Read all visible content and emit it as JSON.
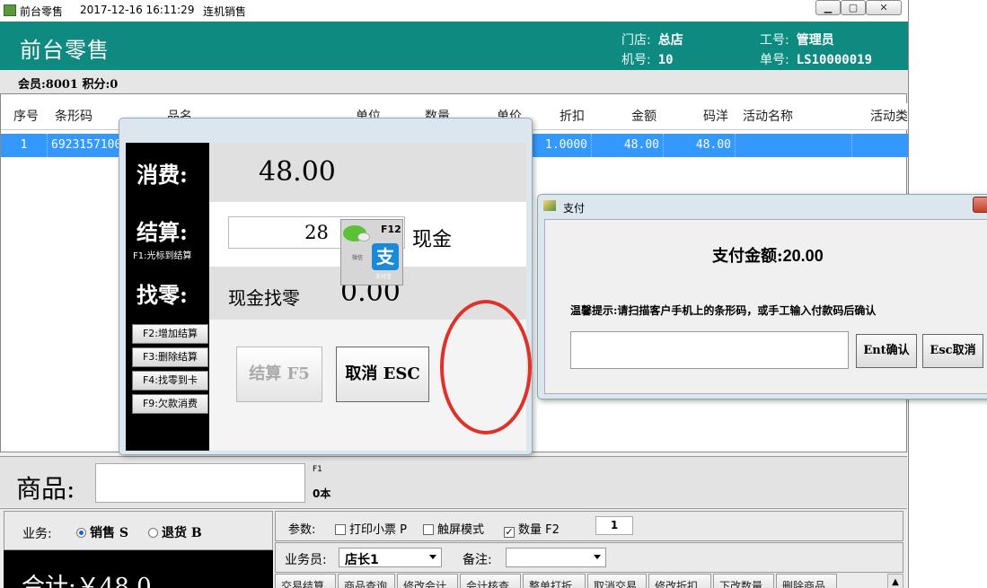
{
  "titlebar": {
    "app": "前台零售",
    "datetime": "2017-12-16 16:11:29",
    "mode": "连机销售"
  },
  "header": {
    "title": "前台零售",
    "store_label": "门店:",
    "store": "总店",
    "machine_label": "机号:",
    "machine": "10",
    "staff_label": "工号:",
    "staff": "管理员",
    "order_label": "单号:",
    "order": "LS10000019"
  },
  "member": {
    "text": "会员:8001 积分:0"
  },
  "grid": {
    "columns": [
      "序号",
      "条形码",
      "品名",
      "单位",
      "数量",
      "单价",
      "折扣",
      "金额",
      "码洋",
      "活动名称",
      "活动类"
    ],
    "rows": [
      {
        "seq": "1",
        "barcode": "6923157100",
        "discount": "1.0000",
        "amount": "48.00",
        "list_price": "48.00"
      }
    ]
  },
  "product": {
    "label": "商品:",
    "hint_key": "F1",
    "count": "0本"
  },
  "business": {
    "label": "业务:",
    "sale": "销售 S",
    "return": "退货 B"
  },
  "total": {
    "text": "合计:￥48.0"
  },
  "params": {
    "label": "参数:",
    "print_receipt": "打印小票 P",
    "touch_mode": "触屏模式",
    "qty": "数量 F2",
    "qty_value": "1"
  },
  "staff_row": {
    "label": "业务员:",
    "value": "店长1",
    "note_label": "备注:"
  },
  "fkeys": [
    "交易结算",
    "商品查询",
    "修改会计",
    "会计核查",
    "整单打折",
    "取消交易",
    "修改折扣",
    "下改数量",
    "删除商品"
  ],
  "checkout": {
    "consume_label": "消费:",
    "consume_value": "48.00",
    "settle_label": "结算:",
    "settle_hint": "F1:光标到结算",
    "settle_value": "28",
    "cash": "现金",
    "change_label": "找零:",
    "change_text": "现金找零",
    "change_value": "0.00",
    "side_buttons": [
      "F2:增加结算",
      "F3:删除结算",
      "F4:找零到卡",
      "F9:欠款消费"
    ],
    "settle_button": "结算 F5",
    "cancel_button": "取消 ESC",
    "pay_icon_key": "F12",
    "wechat": "微信",
    "alipay": "支付宝"
  },
  "pay": {
    "title": "支付",
    "amount_label": "支付金额:",
    "amount": "20.00",
    "tip": "温馨提示:请扫描客户手机上的条形码，或手工输入付款码后确认",
    "ok_button": "Ent确认",
    "cancel_button": "Esc取消"
  },
  "colors": {
    "header": "#0f8a80",
    "selection": "#3399ff",
    "highlight": "#e0302a"
  }
}
